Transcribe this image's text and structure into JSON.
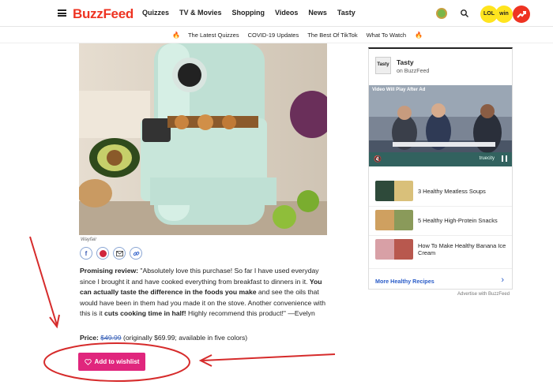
{
  "header": {
    "logo": "BuzzFeed",
    "nav": [
      "Quizzes",
      "TV & Movies",
      "Shopping",
      "Videos",
      "News",
      "Tasty"
    ],
    "badges": {
      "lol": "LOL",
      "win": "win"
    },
    "colors": {
      "brand": "#ee3322",
      "badge_yellow": "#ffe41e"
    }
  },
  "subnav": {
    "items": [
      "The Latest Quizzes",
      "COVID-19 Updates",
      "The Best Of TikTok",
      "What To Watch"
    ],
    "icon": "fire-icon"
  },
  "product": {
    "image_credit": "Wayfair",
    "share_icons": [
      "facebook-icon",
      "pinterest-icon",
      "email-icon",
      "link-icon"
    ],
    "review": {
      "lead": "Promising review:",
      "p1": " \"Absolutely love this purchase! So far I have used everyday since I brought it and have cooked everything from breakfast to dinners in it. ",
      "b1": "You can actually taste the difference in the foods you make",
      "p2": " and see the oils that would have been in them had you made it on the stove. Another convenience with this is it ",
      "b2": "cuts cooking time in half!",
      "p3": " Highly recommend this product!\" —Evelyn"
    },
    "price": {
      "label": "Price:",
      "old": "$49.99",
      "rest": " (originally $69.99; available in five colors)"
    },
    "wishlist_label": "Add to wishlist"
  },
  "sidebar": {
    "brand": "Tasty",
    "brand_sub": "on BuzzFeed",
    "logo_text": "Tasty",
    "video_label": "Video Will Play After Ad",
    "video_brand": "truecity",
    "recipes": [
      {
        "title": "3 Healthy Meatless Soups",
        "color": "#8a9a5a"
      },
      {
        "title": "5 Healthy High-Protein Snacks",
        "color": "#c9a26a"
      },
      {
        "title": "How To Make Healthy Banana Ice Cream",
        "color": "#b8584e"
      }
    ],
    "more_link": "More Healthy Recipes",
    "advertise": "Advertise with BuzzFeed"
  }
}
